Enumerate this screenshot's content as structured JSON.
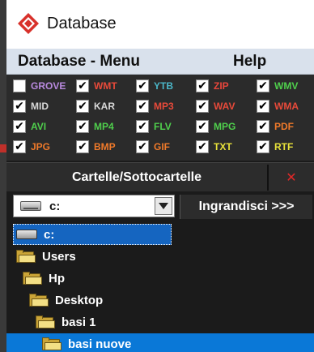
{
  "window": {
    "title": "Database",
    "logo_icon": "red-diamond-logo-icon",
    "accent_color": "#d8312b"
  },
  "menu": {
    "database": "Database - Menu",
    "help": "Help"
  },
  "extensions": [
    {
      "label": "GROVE",
      "checked": false,
      "color": "#b98adf"
    },
    {
      "label": "WMT",
      "checked": true,
      "color": "#e84a3a"
    },
    {
      "label": "YTB",
      "checked": true,
      "color": "#4bb6c8"
    },
    {
      "label": "ZIP",
      "checked": true,
      "color": "#e8463b"
    },
    {
      "label": "WMV",
      "checked": true,
      "color": "#4fcf4c"
    },
    {
      "label": "MID",
      "checked": true,
      "color": "#d8d8d8"
    },
    {
      "label": "KAR",
      "checked": true,
      "color": "#d8d8d8"
    },
    {
      "label": "MP3",
      "checked": true,
      "color": "#e84a3a"
    },
    {
      "label": "WAV",
      "checked": true,
      "color": "#e84a3a"
    },
    {
      "label": "WMA",
      "checked": true,
      "color": "#e84a3a"
    },
    {
      "label": "AVI",
      "checked": true,
      "color": "#4fcf4c"
    },
    {
      "label": "MP4",
      "checked": true,
      "color": "#4fcf4c"
    },
    {
      "label": "FLV",
      "checked": true,
      "color": "#4fcf4c"
    },
    {
      "label": "MPG",
      "checked": true,
      "color": "#4fcf4c"
    },
    {
      "label": "PDF",
      "checked": true,
      "color": "#f07a2a"
    },
    {
      "label": "JPG",
      "checked": true,
      "color": "#f07a2a"
    },
    {
      "label": "BMP",
      "checked": true,
      "color": "#f07a2a"
    },
    {
      "label": "GIF",
      "checked": true,
      "color": "#f07a2a"
    },
    {
      "label": "TXT",
      "checked": true,
      "color": "#e8e23a"
    },
    {
      "label": "RTF",
      "checked": true,
      "color": "#e8e23a"
    }
  ],
  "tabs": {
    "folders": "Cartelle/Sottocartelle",
    "close": "✕"
  },
  "drive_select": {
    "value": "c:",
    "icon": "drive-icon"
  },
  "enlarge_button": "Ingrandisci >>>",
  "tree": [
    {
      "label": "c:",
      "icon": "drive-icon",
      "indent": 0
    },
    {
      "label": "Users",
      "icon": "folder-icon",
      "indent": 0
    },
    {
      "label": "Hp",
      "icon": "folder-icon",
      "indent": 1
    },
    {
      "label": "Desktop",
      "icon": "folder-icon",
      "indent": 2
    },
    {
      "label": "basi 1",
      "icon": "folder-icon",
      "indent": 3
    },
    {
      "label": "basi nuove",
      "icon": "folder-icon",
      "indent": 4
    }
  ]
}
